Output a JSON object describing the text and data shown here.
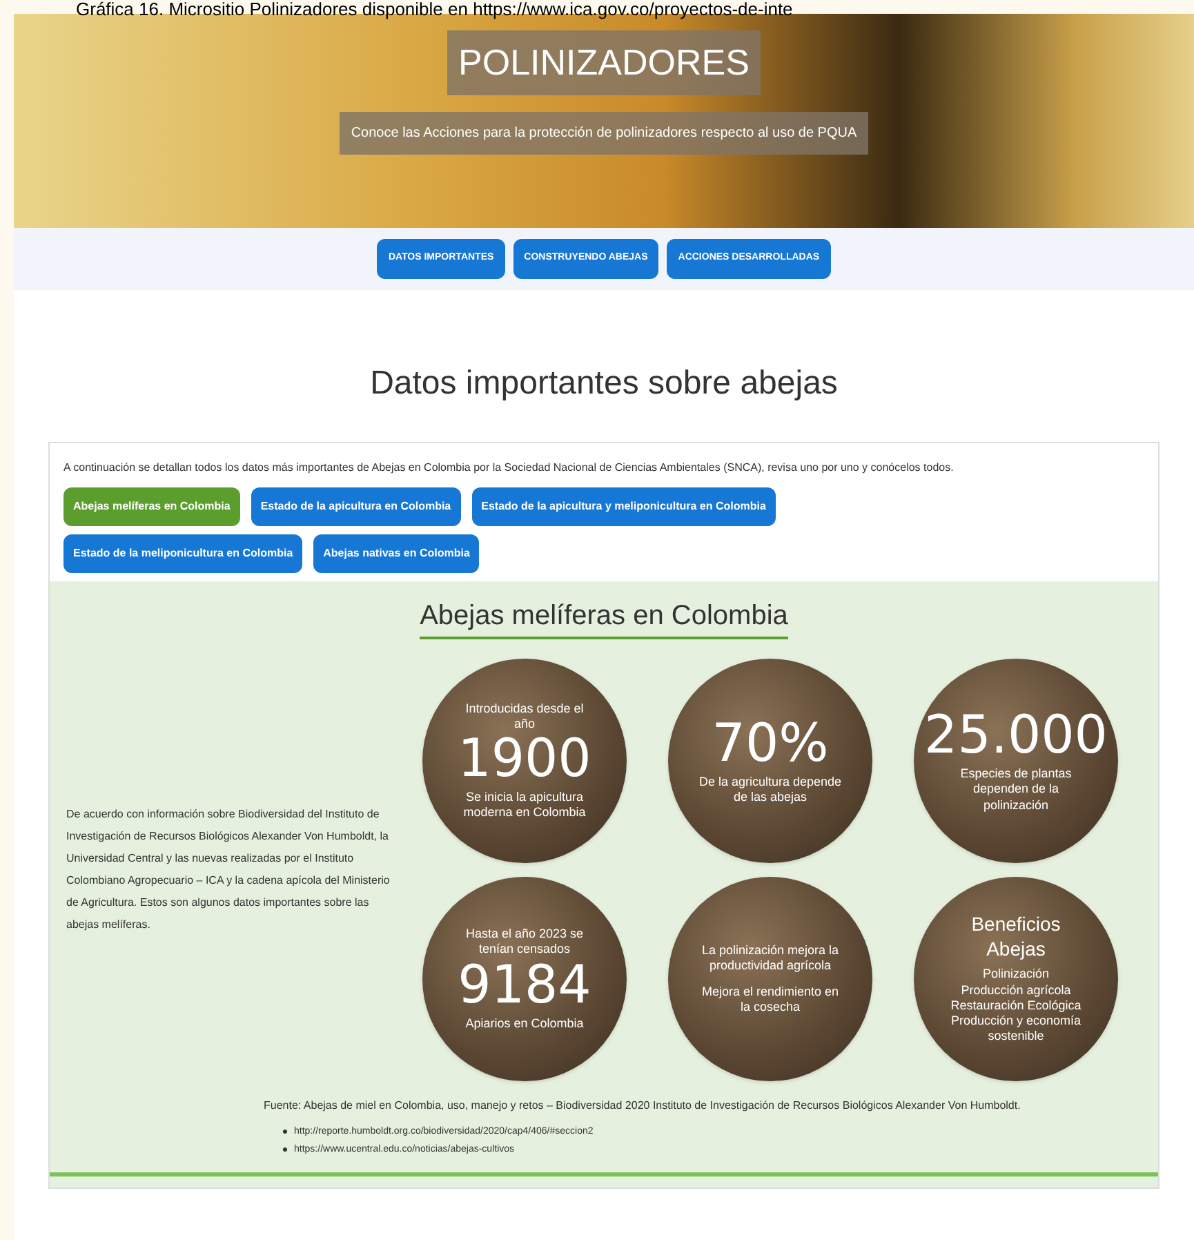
{
  "caption": "Gráfica 16. Micrositio Polinizadores disponible en https://www.ica.gov.co/proyectos-de-inte",
  "hero": {
    "title": "POLINIZADORES",
    "subtitle": "Conoce las Acciones para la protección de polinizadores respecto al uso de PQUA"
  },
  "nav": [
    "DATOS IMPORTANTES",
    "CONSTRUYENDO ABEJAS",
    "ACCIONES DESARROLLADAS"
  ],
  "heading": "Datos importantes sobre abejas",
  "intro": "A continuación se detallan todos los datos más importantes de Abejas en Colombia por la Sociedad Nacional de Ciencias Ambientales (SNCA), revisa uno por uno y conócelos todos.",
  "tabs": [
    {
      "label": "Abejas melíferas en Colombia",
      "selected": true
    },
    {
      "label": "Estado de la apicultura en Colombia",
      "selected": false
    },
    {
      "label": "Estado de la apicultura y meliponicultura en Colombia",
      "selected": false
    },
    {
      "label": "Estado de la meliponicultura en Colombia",
      "selected": false
    },
    {
      "label": "Abejas nativas en Colombia",
      "selected": false
    }
  ],
  "panel": {
    "title": "Abejas melíferas en Colombia",
    "description": "De acuerdo con información sobre Biodiversidad del Instituto de Investigación de Recursos Biológicos Alexander Von Humboldt, la Universidad Central y las nuevas realizadas por el Instituto Colombiano Agropecuario – ICA y la cadena apícola del Ministerio de Agricultura. Estos son algunos datos importantes sobre las abejas melíferas.",
    "stats": [
      {
        "kind": "number",
        "top": "Introducidas desde el año",
        "value": "1900",
        "bottom": "Se inicia la apicultura moderna en Colombia"
      },
      {
        "kind": "number",
        "value": "70%",
        "bottom": "De la agricultura depende de las abejas"
      },
      {
        "kind": "number",
        "value": "25.000",
        "bottom": "Especies de plantas dependen de la polinización"
      },
      {
        "kind": "number",
        "top": "Hasta el año 2023 se tenían censados",
        "value": "9184",
        "bottom": "Apiarios en Colombia"
      },
      {
        "kind": "text",
        "lines": [
          "La polinización mejora la productividad agrícola",
          "Mejora el rendimiento en la cosecha"
        ]
      },
      {
        "kind": "list",
        "title": "Beneficios Abejas",
        "lines": [
          "Polinización",
          "Producción agrícola",
          "Restauración Ecológica",
          "Producción y economía sostenible"
        ]
      }
    ],
    "source": "Fuente: Abejas de miel en Colombia, uso, manejo y retos – Biodiversidad 2020 Instituto de Investigación de Recursos Biológicos Alexander Von Humboldt.",
    "links": [
      "http://reporte.humboldt.org.co/biodiversidad/2020/cap4/406/#seccion2",
      "https://www.ucentral.edu.co/noticias/abejas-cultivos"
    ]
  }
}
